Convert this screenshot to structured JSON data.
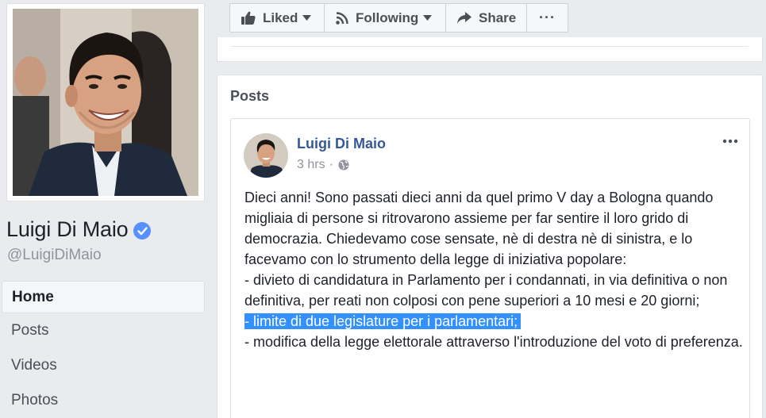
{
  "page": {
    "name": "Luigi Di Maio",
    "handle": "@LuigiDiMaio",
    "verified": true
  },
  "nav": {
    "items": [
      {
        "label": "Home",
        "active": true
      },
      {
        "label": "Posts",
        "active": false
      },
      {
        "label": "Videos",
        "active": false
      },
      {
        "label": "Photos",
        "active": false
      }
    ]
  },
  "actions": {
    "liked": "Liked",
    "following": "Following",
    "share": "Share",
    "more": "···"
  },
  "posts": {
    "heading": "Posts",
    "post": {
      "author": "Luigi Di Maio",
      "time": "3 hrs",
      "separator": "·",
      "options": "···",
      "paragraphs": [
        "Dieci anni! Sono passati dieci anni da quel primo V day a Bologna quando migliaia di persone si ritrovarono assieme per far sentire il loro grido di democrazia. Chiedevamo cose sensate, nè di destra nè di sinistra, e lo facevamo con lo strumento della legge di iniziativa popolare:",
        "- divieto di candidatura in Parlamento per i condannati, in via definitiva o non definitiva, per reati non colposi con pene superiori a 10 mesi e 20 giorni;",
        "- limite di due legislature per i parlamentari;",
        "- modifica della legge elettorale attraverso l'introduzione del voto di preferenza."
      ],
      "highlighted_paragraph_index": 2
    }
  },
  "icons": {
    "liked": "thumbs-up-icon",
    "following": "rss-icon",
    "share": "share-arrow-icon",
    "verified": "verified-check-icon",
    "globe": "globe-icon"
  },
  "colors": {
    "link": "#365899",
    "verified": "#5890ff",
    "selection": "#3390ff",
    "background": "#e9ebee"
  }
}
